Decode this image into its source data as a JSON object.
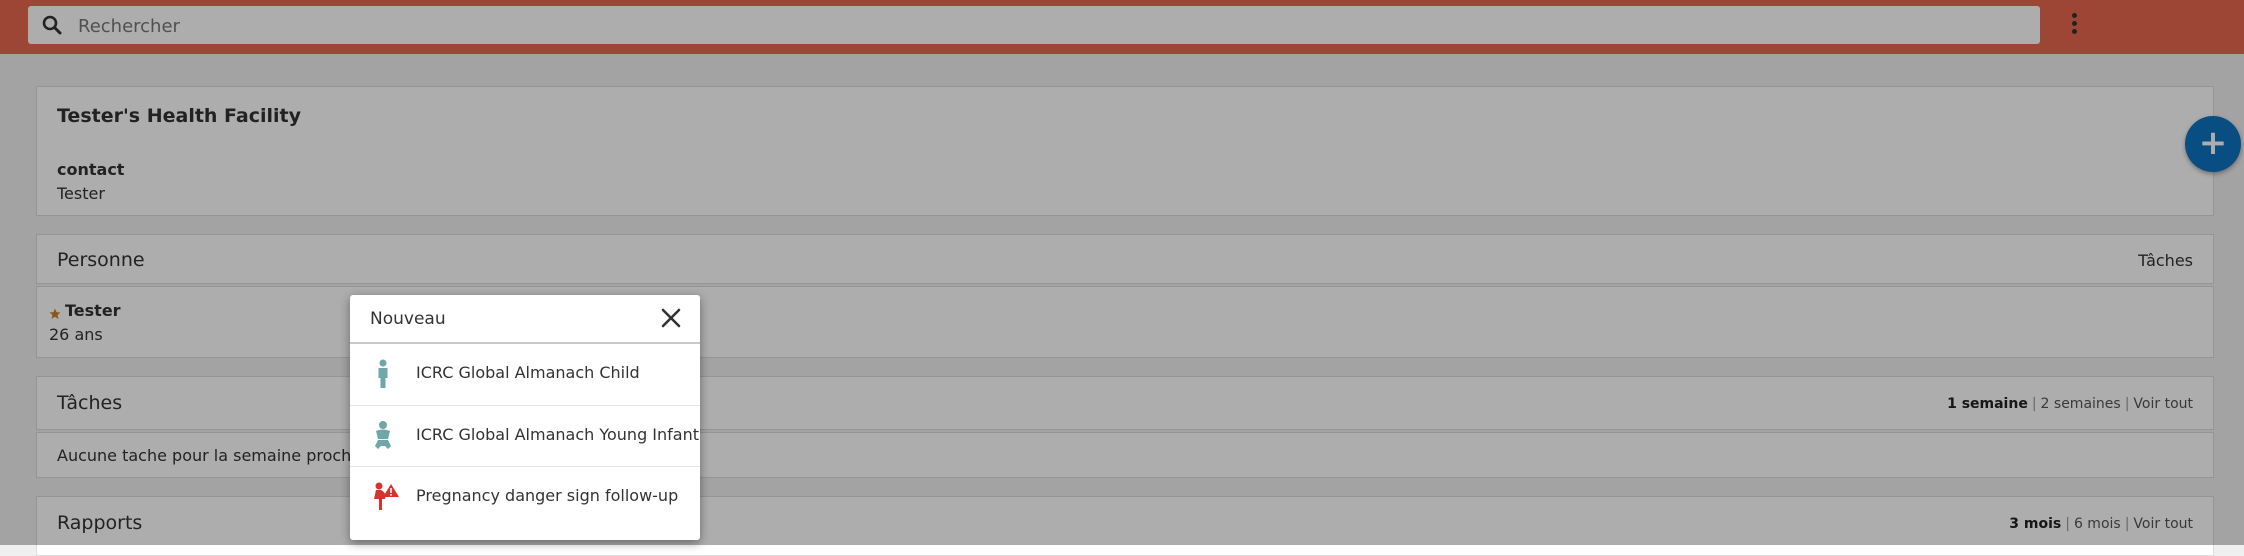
{
  "search": {
    "placeholder": "Rechercher"
  },
  "facility": {
    "title": "Tester's Health Facility",
    "contact_label": "contact",
    "contact_value": "Tester"
  },
  "persons": {
    "header": "Personne",
    "tasks_link": "Tâches",
    "item": {
      "name": "Tester",
      "age": "26 ans"
    }
  },
  "tasks": {
    "header": "Tâches",
    "filter_active": "1 semaine",
    "filter_2": "2 semaines",
    "filter_all": "Voir tout",
    "separator": "|",
    "empty_text": "Aucune tache pour la semaine prochaine"
  },
  "reports": {
    "header": "Rapports",
    "filter_active": "3 mois",
    "filter_2": "6 mois",
    "filter_all": "Voir tout",
    "separator": "|"
  },
  "fab": {
    "label": "+"
  },
  "modal": {
    "title": "Nouveau",
    "items": [
      {
        "label": "ICRC Global Almanach Child",
        "icon": "child-icon"
      },
      {
        "label": "ICRC Global Almanach Young Infant",
        "icon": "infant-icon"
      },
      {
        "label": "Pregnancy danger sign follow-up",
        "icon": "pregnancy-danger-icon"
      }
    ]
  },
  "colors": {
    "header_bg": "#e8674e",
    "fab_bg": "#0c73c2",
    "icon_teal": "#6fa6a8",
    "icon_red": "#d7322b",
    "star": "#c8802e"
  }
}
